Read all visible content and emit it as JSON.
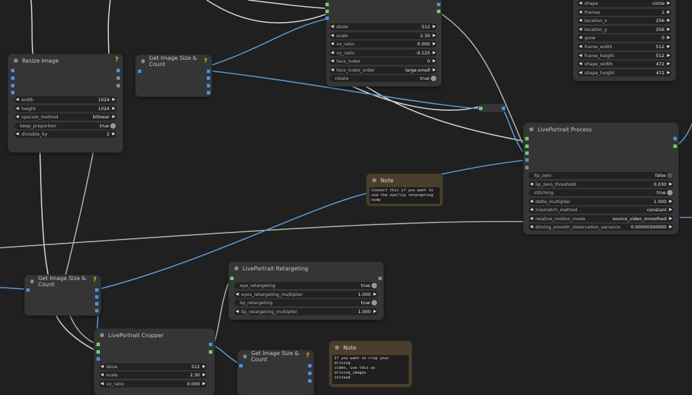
{
  "nodes": {
    "resize_image": {
      "title": "Resize Image",
      "widgets": [
        {
          "label": "width",
          "value": "1024"
        },
        {
          "label": "height",
          "value": "1024"
        },
        {
          "label": "upscale_method",
          "value": "bilinear"
        },
        {
          "label": "keep_proportion",
          "value": "true"
        },
        {
          "label": "divisible_by",
          "value": "2"
        }
      ]
    },
    "size_count_top": {
      "title": "Get Image Size & Count"
    },
    "size_count_left": {
      "title": "Get Image Size & Count"
    },
    "size_count_bottom": {
      "title": "Get Image Size & Count"
    },
    "top_cropper": {
      "widgets": [
        {
          "label": "dsize",
          "value": "512"
        },
        {
          "label": "scale",
          "value": "2.30"
        },
        {
          "label": "vx_ratio",
          "value": "0.000"
        },
        {
          "label": "vy_ratio",
          "value": "-0.125"
        },
        {
          "label": "face_index",
          "value": "0"
        },
        {
          "label": "face_index_order",
          "value": "large-small"
        },
        {
          "label": "rotate",
          "value": "true"
        }
      ]
    },
    "top_right_mask": {
      "widgets": [
        {
          "label": "shape",
          "value": "circle"
        },
        {
          "label": "frames",
          "value": "1"
        },
        {
          "label": "location_x",
          "value": "256"
        },
        {
          "label": "location_y",
          "value": "256"
        },
        {
          "label": "grow",
          "value": "0"
        },
        {
          "label": "frame_width",
          "value": "512"
        },
        {
          "label": "frame_height",
          "value": "512"
        },
        {
          "label": "shape_width",
          "value": "472"
        },
        {
          "label": "shape_height",
          "value": "472"
        }
      ]
    },
    "liveportrait_process": {
      "title": "LivePortrait Process",
      "widgets": [
        {
          "label": "lip_zero",
          "value": "false"
        },
        {
          "label": "lip_zero_threshold",
          "value": "0.030"
        },
        {
          "label": "stitching",
          "value": "true"
        },
        {
          "label": "delta_multiplier",
          "value": "1.000"
        },
        {
          "label": "mismatch_method",
          "value": "constant"
        },
        {
          "label": "relative_motion_mode",
          "value": "source_video_smoothed"
        },
        {
          "label": "driving_smooth_observation_variance",
          "value": "0.00000300000"
        }
      ]
    },
    "retargeting": {
      "title": "LivePortrait Retargeting",
      "widgets": [
        {
          "label": "eye_retargeting",
          "value": "true"
        },
        {
          "label": "eyes_retargeting_multiplier",
          "value": "1.000"
        },
        {
          "label": "lip_retargeting",
          "value": "true"
        },
        {
          "label": "lip_retargeting_multiplier",
          "value": "1.000"
        }
      ]
    },
    "cropper_bottom": {
      "title": "LivePortrait Cropper",
      "widgets": [
        {
          "label": "dsize",
          "value": "512"
        },
        {
          "label": "scale",
          "value": "2.30"
        },
        {
          "label": "vx_ratio",
          "value": "0.000"
        }
      ]
    },
    "note_mid": {
      "title": "Note",
      "text": "Connect this if you want to\nuse the eye/lip retargeting\nnode"
    },
    "note_bottom": {
      "title": "Note",
      "text": "If you want to crop your driving\nvideo, use this as driving_images\ninstead"
    }
  },
  "icons": {
    "help": "?",
    "arrow_left": "◀",
    "arrow_right": "▶"
  },
  "colors": {
    "background": "#202020",
    "node": "#353535",
    "wire_blue": "#5b9bd8",
    "wire_white": "#d8d8d8",
    "wire_green": "#a8b8a0",
    "port_green": "#6fcf6f",
    "port_blue": "#4a90d9",
    "help": "#e0b020"
  }
}
